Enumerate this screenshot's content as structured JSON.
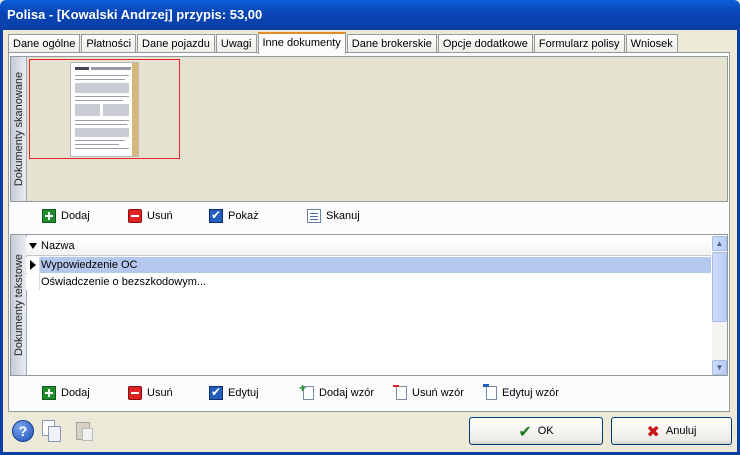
{
  "window": {
    "title": "Polisa - [Kowalski Andrzej] przypis: 53,00"
  },
  "tabs": [
    {
      "label": "Dane ogólne"
    },
    {
      "label": "Płatności"
    },
    {
      "label": "Dane pojazdu"
    },
    {
      "label": "Uwagi"
    },
    {
      "label": "Inne dokumenty"
    },
    {
      "label": "Dane brokerskie"
    },
    {
      "label": "Opcje dodatkowe"
    },
    {
      "label": "Formularz polisy"
    },
    {
      "label": "Wniosek"
    }
  ],
  "active_tab": "Inne dokumenty",
  "scanned": {
    "section_label": "Dokumenty skanowane",
    "toolbar": {
      "add": "Dodaj",
      "remove": "Usuń",
      "show": "Pokaż",
      "scan": "Skanuj"
    }
  },
  "text_docs": {
    "section_label": "Dokumenty tekstowe",
    "column_header": "Nazwa",
    "rows": [
      {
        "name": "Wypowiedzenie OC"
      },
      {
        "name": "Oświadczenie o bezszkodowym..."
      }
    ],
    "toolbar": {
      "add": "Dodaj",
      "remove": "Usuń",
      "edit": "Edytuj",
      "add_template": "Dodaj wzór",
      "remove_template": "Usuń wzór",
      "edit_template": "Edytuj wzór"
    }
  },
  "buttons": {
    "ok": "OK",
    "cancel": "Anuluj"
  },
  "icons": {
    "help": "help-icon",
    "copy": "copy-icon",
    "paste": "paste-icon"
  },
  "colors": {
    "title_bar": "#0846b8",
    "selection": "#b4c8ee",
    "active_tab_accent": "#e68b2c"
  }
}
